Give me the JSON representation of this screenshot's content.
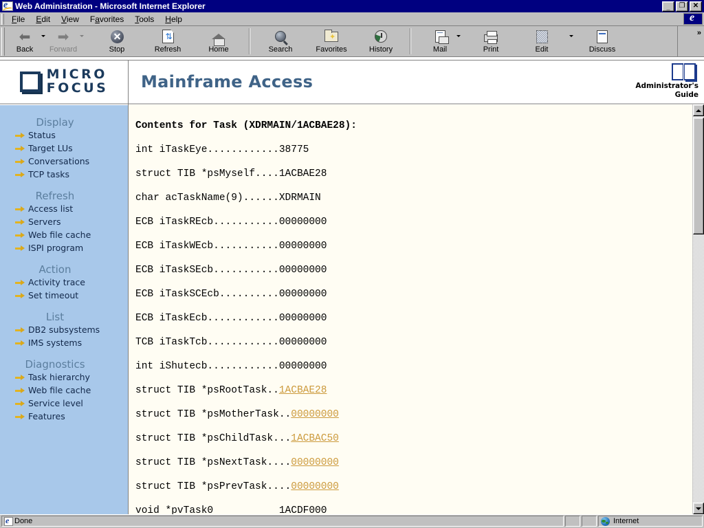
{
  "window": {
    "title": "Web Administration - Microsoft Internet Explorer",
    "icon": "ie-document-icon",
    "minimize_label": "_",
    "maximize_label": "❐",
    "close_label": "✕"
  },
  "menubar": {
    "items": [
      {
        "label": "File",
        "accel": "F"
      },
      {
        "label": "Edit",
        "accel": "E"
      },
      {
        "label": "View",
        "accel": "V"
      },
      {
        "label": "Favorites",
        "accel": "a"
      },
      {
        "label": "Tools",
        "accel": "T"
      },
      {
        "label": "Help",
        "accel": "H"
      }
    ]
  },
  "toolbar": {
    "chevron": "»",
    "buttons": [
      {
        "label": "Back",
        "icon": "back-arrow-icon",
        "disabled": false,
        "dropdown": true
      },
      {
        "label": "Forward",
        "icon": "forward-arrow-icon",
        "disabled": true,
        "dropdown": true
      },
      {
        "label": "Stop",
        "icon": "stop-icon",
        "disabled": false,
        "dropdown": false
      },
      {
        "label": "Refresh",
        "icon": "refresh-icon",
        "disabled": false,
        "dropdown": false
      },
      {
        "label": "Home",
        "icon": "home-icon",
        "disabled": false,
        "dropdown": false
      },
      {
        "label": "Search",
        "icon": "search-icon",
        "disabled": false,
        "dropdown": false
      },
      {
        "label": "Favorites",
        "icon": "favorites-icon",
        "disabled": false,
        "dropdown": false
      },
      {
        "label": "History",
        "icon": "history-icon",
        "disabled": false,
        "dropdown": false
      },
      {
        "label": "Mail",
        "icon": "mail-icon",
        "disabled": false,
        "dropdown": true
      },
      {
        "label": "Print",
        "icon": "print-icon",
        "disabled": false,
        "dropdown": false
      },
      {
        "label": "Edit",
        "icon": "edit-icon",
        "disabled": false,
        "dropdown": true
      },
      {
        "label": "Discuss",
        "icon": "discuss-icon",
        "disabled": false,
        "dropdown": false
      }
    ]
  },
  "branding": {
    "logo_line1": "MICRO",
    "logo_line2": "FOCUS",
    "logo_icon": "micro-focus-square-icon"
  },
  "header": {
    "title": "Mainframe Access",
    "admin_guide_line1": "Administrator's",
    "admin_guide_line2": "Guide",
    "admin_guide_icon": "open-book-icon"
  },
  "sidebar": {
    "groups": [
      {
        "heading": "Display",
        "items": [
          "Status",
          "Target LUs",
          "Conversations",
          "TCP tasks"
        ]
      },
      {
        "heading": "Refresh",
        "items": [
          "Access list",
          "Servers",
          "Web file cache",
          "ISPI program"
        ]
      },
      {
        "heading": "Action",
        "items": [
          "Activity trace",
          "Set timeout"
        ]
      },
      {
        "heading": "List",
        "items": [
          "DB2 subsystems",
          "IMS systems"
        ]
      },
      {
        "heading": "Diagnostics",
        "items": [
          "Task hierarchy",
          "Web file cache",
          "Service level",
          "Features"
        ]
      }
    ]
  },
  "content": {
    "heading": "Contents for Task (XDRMAIN/1ACBAE28):",
    "rows": [
      {
        "text": "int iTaskEye............38775",
        "link": null
      },
      {
        "text": "struct TIB *psMyself....1ACBAE28",
        "link": null
      },
      {
        "text": "char acTaskName(9)......XDRMAIN",
        "link": null
      },
      {
        "text": "ECB iTaskREcb...........00000000",
        "link": null
      },
      {
        "text": "ECB iTaskWEcb...........00000000",
        "link": null
      },
      {
        "text": "ECB iTaskSEcb...........00000000",
        "link": null
      },
      {
        "text": "ECB iTaskSCEcb..........00000000",
        "link": null
      },
      {
        "text": "ECB iTaskEcb............00000000",
        "link": null
      },
      {
        "text": "TCB iTaskTcb............00000000",
        "link": null
      },
      {
        "text": "int iShutecb............00000000",
        "link": null
      },
      {
        "text": "struct TIB *psRootTask..",
        "link": "1ACBAE28"
      },
      {
        "text": "struct TIB *psMotherTask..",
        "link": "00000000"
      },
      {
        "text": "struct TIB *psChildTask...",
        "link": "1ACBAC50"
      },
      {
        "text": "struct TIB *psNextTask....",
        "link": "00000000"
      },
      {
        "text": "struct TIB *psPrevTask....",
        "link": "00000000"
      },
      {
        "text": "void *pvTask0           1ACDF000",
        "link": null
      }
    ],
    "link_color": "#cc9a3c"
  },
  "scrollbar": {
    "up_label": "▲",
    "down_label": "▼"
  },
  "statusbar": {
    "status_text": "Done",
    "zone_text": "Internet",
    "zone_icon": "globe-icon",
    "status_icon": "ie-document-icon"
  },
  "colors": {
    "titlebar": "#000080",
    "chrome": "#c0c0c0",
    "sidebar_bg": "#a8c8ea",
    "sidebar_heading": "#5b7e9e",
    "sidebar_link": "#12284a",
    "content_bg": "#fffdf3",
    "brand_blue": "#1b3a5c",
    "header_title": "#3f6387",
    "arrow_bullet": "#e2b321"
  }
}
